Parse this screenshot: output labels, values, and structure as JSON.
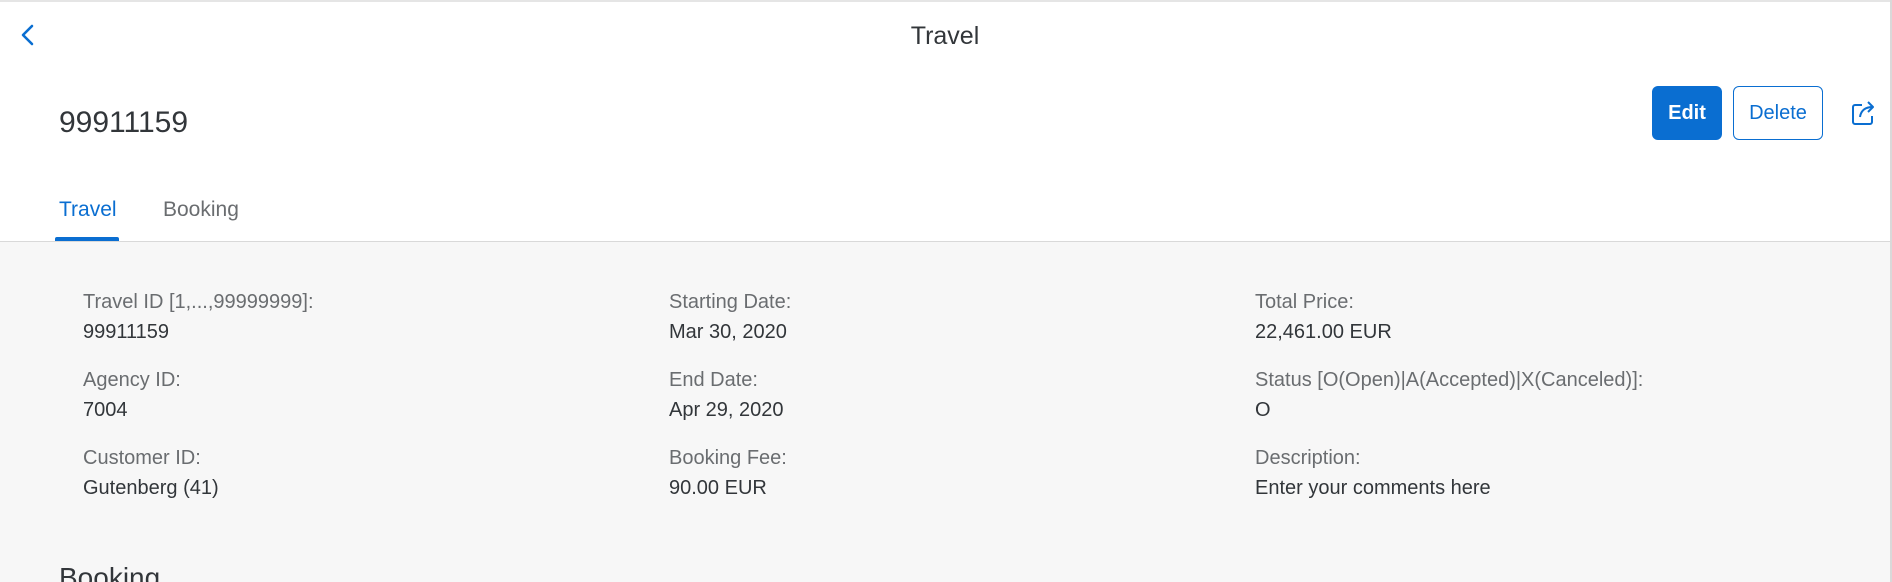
{
  "header": {
    "title": "Travel"
  },
  "object": {
    "title": "99911159"
  },
  "actions": {
    "edit": "Edit",
    "delete": "Delete"
  },
  "tabs": [
    {
      "label": "Travel"
    },
    {
      "label": "Booking"
    }
  ],
  "fields": {
    "travel_id": {
      "label": "Travel ID [1,...,99999999]:",
      "value": "99911159"
    },
    "agency_id": {
      "label": "Agency ID:",
      "value": "7004"
    },
    "customer_id": {
      "label": "Customer ID:",
      "value": "Gutenberg (41)"
    },
    "start_date": {
      "label": "Starting Date:",
      "value": "Mar 30, 2020"
    },
    "end_date": {
      "label": "End Date:",
      "value": "Apr 29, 2020"
    },
    "booking_fee": {
      "label": "Booking Fee:",
      "value": "90.00  EUR"
    },
    "total_price": {
      "label": "Total Price:",
      "value": "22,461.00  EUR"
    },
    "status": {
      "label": "Status [O(Open)|A(Accepted)|X(Canceled)]:",
      "value": "O"
    },
    "description": {
      "label": "Description:",
      "value": "Enter your comments here"
    }
  },
  "sections": {
    "booking_title": "Booking"
  },
  "icons": {
    "back": "chevron-left-icon",
    "share": "share-icon"
  },
  "colors": {
    "accent": "#0a6ed1",
    "text": "#32363a",
    "label": "#6a6d70",
    "content_bg": "#f7f7f7"
  }
}
